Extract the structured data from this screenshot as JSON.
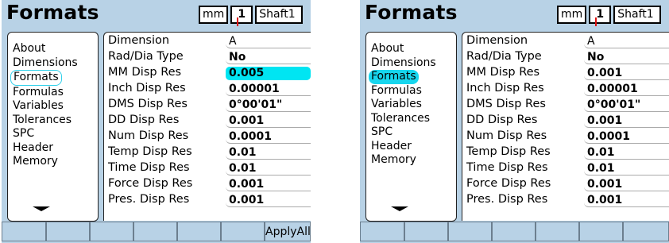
{
  "screens": [
    {
      "title": "Formats",
      "units_button": "mm",
      "datum_button": "1",
      "part_button": "Shaft1",
      "menu": [
        "About",
        "Dimensions",
        "Formats",
        "Formulas",
        "Variables",
        "Tolerances",
        "SPC",
        "Header",
        "Memory"
      ],
      "rows": [
        {
          "label": "Dimension",
          "value": "A"
        },
        {
          "label": "Rad/Dia Type",
          "value": "No"
        },
        {
          "label": "MM Disp Res",
          "value": "0.005"
        },
        {
          "label": "Inch Disp Res",
          "value": "0.00001"
        },
        {
          "label": "DMS Disp Res",
          "value": "0°00'01\""
        },
        {
          "label": "DD Disp Res",
          "value": "0.001"
        },
        {
          "label": "Num Disp Res",
          "value": "0.0001"
        },
        {
          "label": "Temp Disp Res",
          "value": "0.01"
        },
        {
          "label": "Time Disp Res",
          "value": "0.01"
        },
        {
          "label": "Force Disp Res",
          "value": "0.001"
        },
        {
          "label": "Pres. Disp Res",
          "value": "0.001"
        }
      ],
      "softkey_last": "ApplyAll"
    },
    {
      "title": "Formats",
      "units_button": "mm",
      "datum_button": "1",
      "part_button": "Shaft1",
      "menu": [
        "About",
        "Dimensions",
        "Formats",
        "Formulas",
        "Variables",
        "Tolerances",
        "SPC",
        "Header",
        "Memory"
      ],
      "rows": [
        {
          "label": "Dimension",
          "value": "A"
        },
        {
          "label": "Rad/Dia Type",
          "value": "No"
        },
        {
          "label": "MM Disp Res",
          "value": "0.001"
        },
        {
          "label": "Inch Disp Res",
          "value": "0.00001"
        },
        {
          "label": "DMS Disp Res",
          "value": "0°00'01\""
        },
        {
          "label": "DD Disp Res",
          "value": "0.001"
        },
        {
          "label": "Num Disp Res",
          "value": "0.0001"
        },
        {
          "label": "Temp Disp Res",
          "value": "0.01"
        },
        {
          "label": "Time Disp Res",
          "value": "0.01"
        },
        {
          "label": "Force Disp Res",
          "value": "0.001"
        },
        {
          "label": "Pres. Disp Res",
          "value": "0.001"
        }
      ],
      "softkey_last": ""
    }
  ]
}
